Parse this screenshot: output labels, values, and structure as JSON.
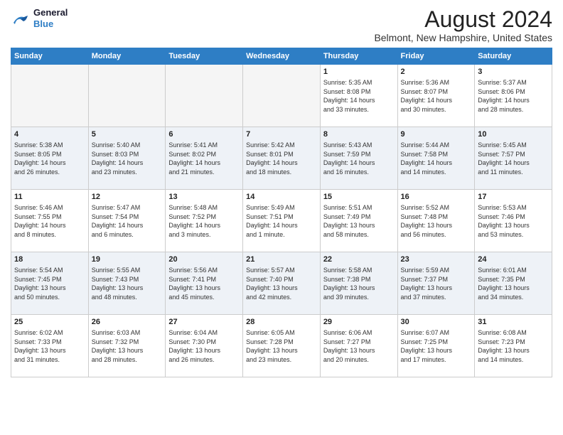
{
  "header": {
    "logo_line1": "General",
    "logo_line2": "Blue",
    "month": "August 2024",
    "location": "Belmont, New Hampshire, United States"
  },
  "days_of_week": [
    "Sunday",
    "Monday",
    "Tuesday",
    "Wednesday",
    "Thursday",
    "Friday",
    "Saturday"
  ],
  "weeks": [
    [
      {
        "day": "",
        "info": ""
      },
      {
        "day": "",
        "info": ""
      },
      {
        "day": "",
        "info": ""
      },
      {
        "day": "",
        "info": ""
      },
      {
        "day": "1",
        "info": "Sunrise: 5:35 AM\nSunset: 8:08 PM\nDaylight: 14 hours\nand 33 minutes."
      },
      {
        "day": "2",
        "info": "Sunrise: 5:36 AM\nSunset: 8:07 PM\nDaylight: 14 hours\nand 30 minutes."
      },
      {
        "day": "3",
        "info": "Sunrise: 5:37 AM\nSunset: 8:06 PM\nDaylight: 14 hours\nand 28 minutes."
      }
    ],
    [
      {
        "day": "4",
        "info": "Sunrise: 5:38 AM\nSunset: 8:05 PM\nDaylight: 14 hours\nand 26 minutes."
      },
      {
        "day": "5",
        "info": "Sunrise: 5:40 AM\nSunset: 8:03 PM\nDaylight: 14 hours\nand 23 minutes."
      },
      {
        "day": "6",
        "info": "Sunrise: 5:41 AM\nSunset: 8:02 PM\nDaylight: 14 hours\nand 21 minutes."
      },
      {
        "day": "7",
        "info": "Sunrise: 5:42 AM\nSunset: 8:01 PM\nDaylight: 14 hours\nand 18 minutes."
      },
      {
        "day": "8",
        "info": "Sunrise: 5:43 AM\nSunset: 7:59 PM\nDaylight: 14 hours\nand 16 minutes."
      },
      {
        "day": "9",
        "info": "Sunrise: 5:44 AM\nSunset: 7:58 PM\nDaylight: 14 hours\nand 14 minutes."
      },
      {
        "day": "10",
        "info": "Sunrise: 5:45 AM\nSunset: 7:57 PM\nDaylight: 14 hours\nand 11 minutes."
      }
    ],
    [
      {
        "day": "11",
        "info": "Sunrise: 5:46 AM\nSunset: 7:55 PM\nDaylight: 14 hours\nand 8 minutes."
      },
      {
        "day": "12",
        "info": "Sunrise: 5:47 AM\nSunset: 7:54 PM\nDaylight: 14 hours\nand 6 minutes."
      },
      {
        "day": "13",
        "info": "Sunrise: 5:48 AM\nSunset: 7:52 PM\nDaylight: 14 hours\nand 3 minutes."
      },
      {
        "day": "14",
        "info": "Sunrise: 5:49 AM\nSunset: 7:51 PM\nDaylight: 14 hours\nand 1 minute."
      },
      {
        "day": "15",
        "info": "Sunrise: 5:51 AM\nSunset: 7:49 PM\nDaylight: 13 hours\nand 58 minutes."
      },
      {
        "day": "16",
        "info": "Sunrise: 5:52 AM\nSunset: 7:48 PM\nDaylight: 13 hours\nand 56 minutes."
      },
      {
        "day": "17",
        "info": "Sunrise: 5:53 AM\nSunset: 7:46 PM\nDaylight: 13 hours\nand 53 minutes."
      }
    ],
    [
      {
        "day": "18",
        "info": "Sunrise: 5:54 AM\nSunset: 7:45 PM\nDaylight: 13 hours\nand 50 minutes."
      },
      {
        "day": "19",
        "info": "Sunrise: 5:55 AM\nSunset: 7:43 PM\nDaylight: 13 hours\nand 48 minutes."
      },
      {
        "day": "20",
        "info": "Sunrise: 5:56 AM\nSunset: 7:41 PM\nDaylight: 13 hours\nand 45 minutes."
      },
      {
        "day": "21",
        "info": "Sunrise: 5:57 AM\nSunset: 7:40 PM\nDaylight: 13 hours\nand 42 minutes."
      },
      {
        "day": "22",
        "info": "Sunrise: 5:58 AM\nSunset: 7:38 PM\nDaylight: 13 hours\nand 39 minutes."
      },
      {
        "day": "23",
        "info": "Sunrise: 5:59 AM\nSunset: 7:37 PM\nDaylight: 13 hours\nand 37 minutes."
      },
      {
        "day": "24",
        "info": "Sunrise: 6:01 AM\nSunset: 7:35 PM\nDaylight: 13 hours\nand 34 minutes."
      }
    ],
    [
      {
        "day": "25",
        "info": "Sunrise: 6:02 AM\nSunset: 7:33 PM\nDaylight: 13 hours\nand 31 minutes."
      },
      {
        "day": "26",
        "info": "Sunrise: 6:03 AM\nSunset: 7:32 PM\nDaylight: 13 hours\nand 28 minutes."
      },
      {
        "day": "27",
        "info": "Sunrise: 6:04 AM\nSunset: 7:30 PM\nDaylight: 13 hours\nand 26 minutes."
      },
      {
        "day": "28",
        "info": "Sunrise: 6:05 AM\nSunset: 7:28 PM\nDaylight: 13 hours\nand 23 minutes."
      },
      {
        "day": "29",
        "info": "Sunrise: 6:06 AM\nSunset: 7:27 PM\nDaylight: 13 hours\nand 20 minutes."
      },
      {
        "day": "30",
        "info": "Sunrise: 6:07 AM\nSunset: 7:25 PM\nDaylight: 13 hours\nand 17 minutes."
      },
      {
        "day": "31",
        "info": "Sunrise: 6:08 AM\nSunset: 7:23 PM\nDaylight: 13 hours\nand 14 minutes."
      }
    ]
  ]
}
